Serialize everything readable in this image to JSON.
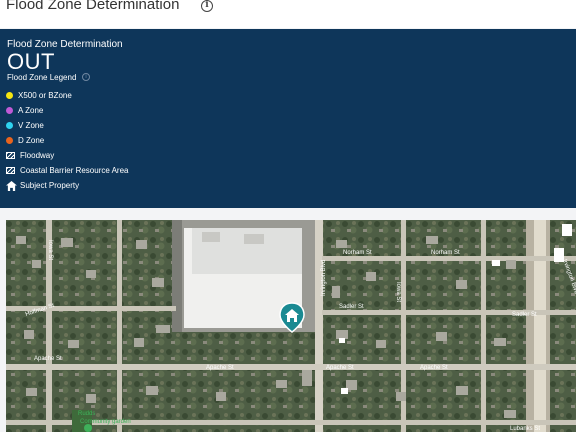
{
  "header": {
    "title": "Flood Zone Determination",
    "info_icon": "info-circle-icon"
  },
  "panel": {
    "subtitle": "Flood Zone Determination",
    "status": "OUT",
    "legend_title": "Flood Zone Legend",
    "legend": [
      {
        "label": "X500 or BZone",
        "color": "#f5e611",
        "icon": "dot"
      },
      {
        "label": "A Zone",
        "color": "#c05ad6",
        "icon": "dot"
      },
      {
        "label": "V Zone",
        "color": "#2ed3f0",
        "icon": "dot"
      },
      {
        "label": "D Zone",
        "color": "#e8641e",
        "icon": "dot"
      },
      {
        "label": "Floodway",
        "icon": "hatch-swatch"
      },
      {
        "label": "Coastal Barrier Resource Area",
        "icon": "hatch-swatch"
      },
      {
        "label": "Subject Property",
        "icon": "home-icon"
      }
    ]
  },
  "map": {
    "streets": {
      "norham": "Norham St",
      "norham_right": "Norham St",
      "sadler": "Sadler St",
      "sadler_right": "Sadler St",
      "apache_left": "Apache St",
      "apache_mid": "Apache St",
      "apache_right": "Apache St",
      "lubanks": "Lubanks St",
      "hoffman": "Hoffman St",
      "irvington": "Irvington Blvd",
      "iowa": "Iowa St",
      "poi_line1": "Rudds",
      "poi_line2": "Community garden"
    },
    "marker_icon": "home-map-pin-icon"
  }
}
